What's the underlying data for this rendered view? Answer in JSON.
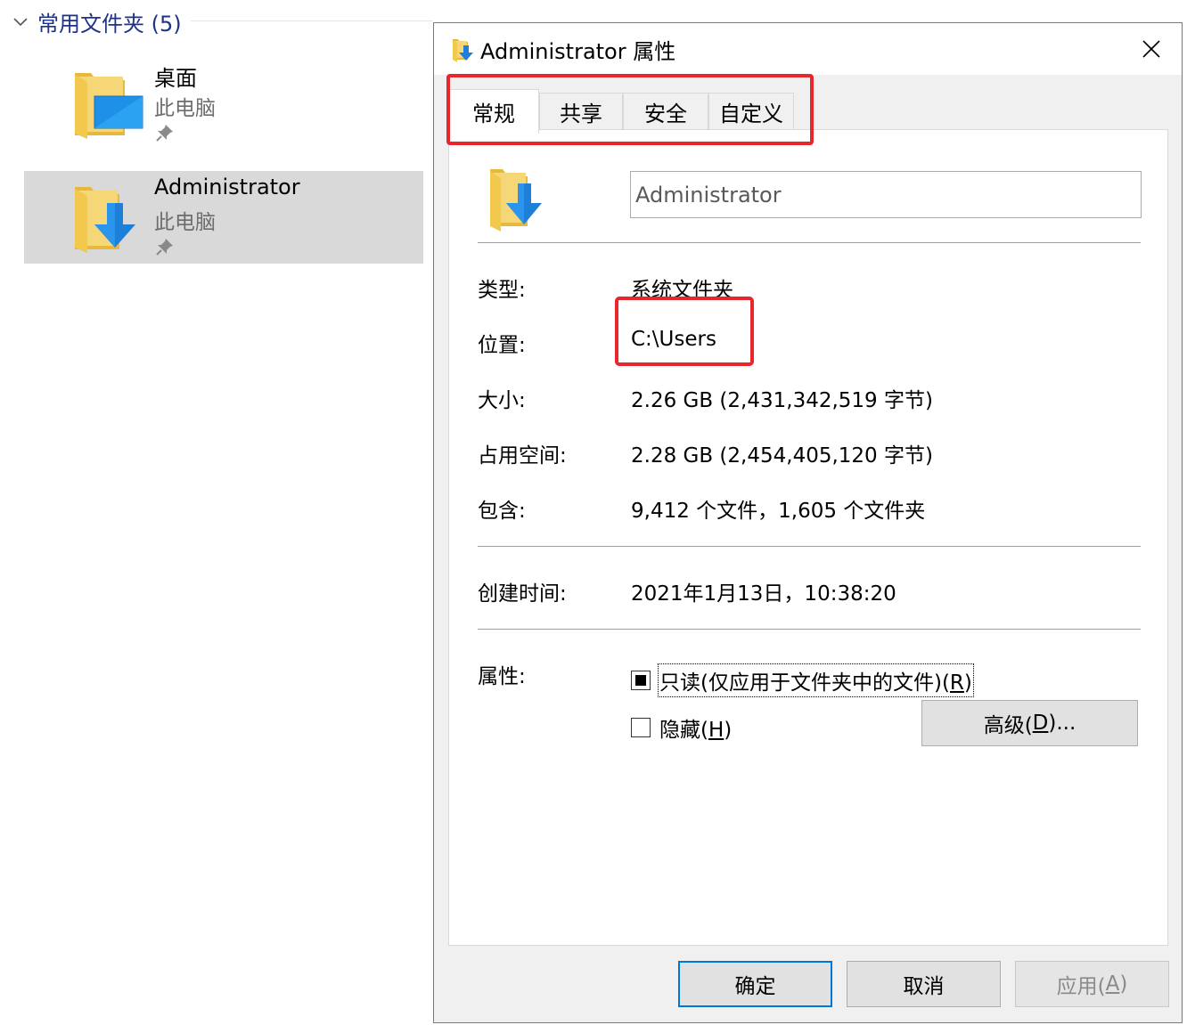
{
  "explorer": {
    "group_header": "常用文件夹 (5)",
    "items": [
      {
        "name": "桌面",
        "location": "此电脑",
        "icon": "desktop-folder-icon",
        "pinned": true,
        "selected": false
      },
      {
        "name": "Administrator",
        "location": "此电脑",
        "icon": "downloads-folder-icon",
        "pinned": true,
        "selected": true
      }
    ]
  },
  "dialog": {
    "title": "Administrator 属性",
    "tabs": [
      {
        "label": "常规",
        "active": true
      },
      {
        "label": "共享",
        "active": false
      },
      {
        "label": "安全",
        "active": false
      },
      {
        "label": "自定义",
        "active": false
      }
    ],
    "folder_name": "Administrator",
    "props": {
      "type": {
        "label": "类型:",
        "value": "系统文件夹"
      },
      "location": {
        "label": "位置:",
        "value": "C:\\Users"
      },
      "size": {
        "label": "大小:",
        "value": "2.26 GB (2,431,342,519 字节)"
      },
      "size_on_disk": {
        "label": "占用空间:",
        "value": "2.28 GB (2,454,405,120 字节)"
      },
      "contains": {
        "label": "包含:",
        "value": "9,412 个文件，1,605 个文件夹"
      },
      "created": {
        "label": "创建时间:",
        "value": "2021年1月13日，10:38:20"
      }
    },
    "attributes": {
      "label": "属性:",
      "readonly": {
        "text": "只读(仅应用于文件夹中的文件)(",
        "mnemonic": "R",
        "suffix": ")",
        "state": "indeterminate"
      },
      "hidden": {
        "text": "隐藏(",
        "mnemonic": "H",
        "suffix": ")",
        "checked": false
      },
      "advanced": {
        "text": "高级(",
        "mnemonic": "D",
        "suffix": ")..."
      }
    },
    "buttons": {
      "ok": "确定",
      "cancel": "取消",
      "apply": {
        "text": "应用(",
        "mnemonic": "A",
        "suffix": ")"
      }
    },
    "highlight_color": "#e8262c",
    "accent": "#0078d7"
  }
}
